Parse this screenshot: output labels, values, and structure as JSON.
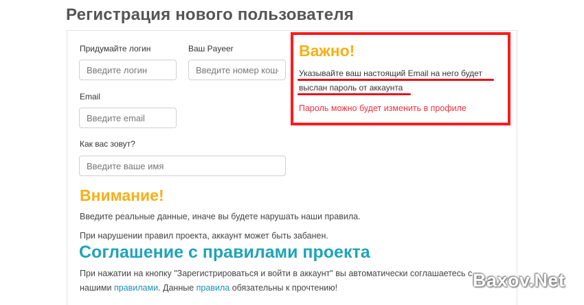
{
  "page": {
    "title": "Регистрация нового пользователя"
  },
  "form": {
    "login_label": "Придумайте логин",
    "login_placeholder": "Введите логин",
    "payeer_label": "Ваш Payeer",
    "payeer_placeholder": "Введите номер коше",
    "email_label": "Email",
    "email_placeholder": "Введите email",
    "name_label": "Как вас зовут?",
    "name_placeholder": "Введите ваше имя"
  },
  "notice": {
    "title": "Важно!",
    "line1": "Указывайте ваш настоящий Email на него будет",
    "line2": "выслан пароль от аккаунта",
    "password_note": "Пароль можно будет изменить в профиле"
  },
  "warning": {
    "title": "Внимание!",
    "text1": "Введите реальные данные, иначе вы будете нарушать наши правила.",
    "text2": "При нарушении правил проекта, аккаунт может быть забанен."
  },
  "agreement": {
    "title": "Соглашение с правилами проекта",
    "text1": "При нажатии на кнопку \"Зарегистрироваться и войти в аккаунт\" вы автоматически соглашаетесь с",
    "text2_start": "нашими",
    "rules_link_1": "правилами",
    "text2_mid": ". Данные",
    "rules_link_2": "правила",
    "text2_end": "обязательны к прочтению!"
  },
  "watermark": {
    "text": "Baxov.Net"
  },
  "colors": {
    "accent_yellow": "#f7b016",
    "accent_teal": "#1fa3b8",
    "highlight_red": "#ff1a1a",
    "link_blue": "#1a8fb8"
  }
}
